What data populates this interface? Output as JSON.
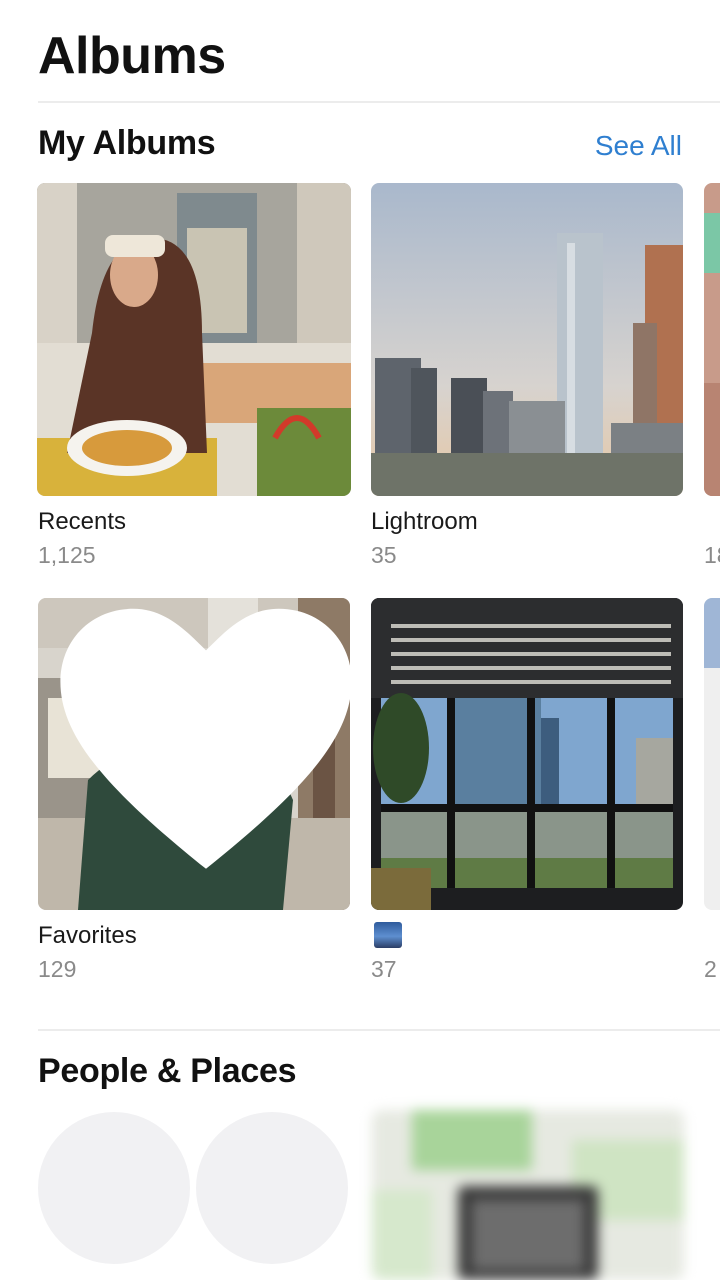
{
  "header": {
    "title": "Albums"
  },
  "my_albums": {
    "title": "My Albums",
    "see_all": "See All",
    "albums": [
      {
        "name": "Recents",
        "count": "1,125"
      },
      {
        "name": "Lightroom",
        "count": "35"
      },
      {
        "name": "Favorites",
        "count": "129"
      },
      {
        "name": "",
        "count": "37"
      }
    ],
    "partial_counts": [
      "18",
      "2"
    ]
  },
  "people_places": {
    "title": "People & Places"
  },
  "icons": {
    "favorites_badge": "heart-icon",
    "album_title_icon": "city-photo-icon"
  },
  "colors": {
    "accent": "#2f7fd0",
    "secondary_text": "#8a8a8a",
    "divider": "#ececec"
  }
}
